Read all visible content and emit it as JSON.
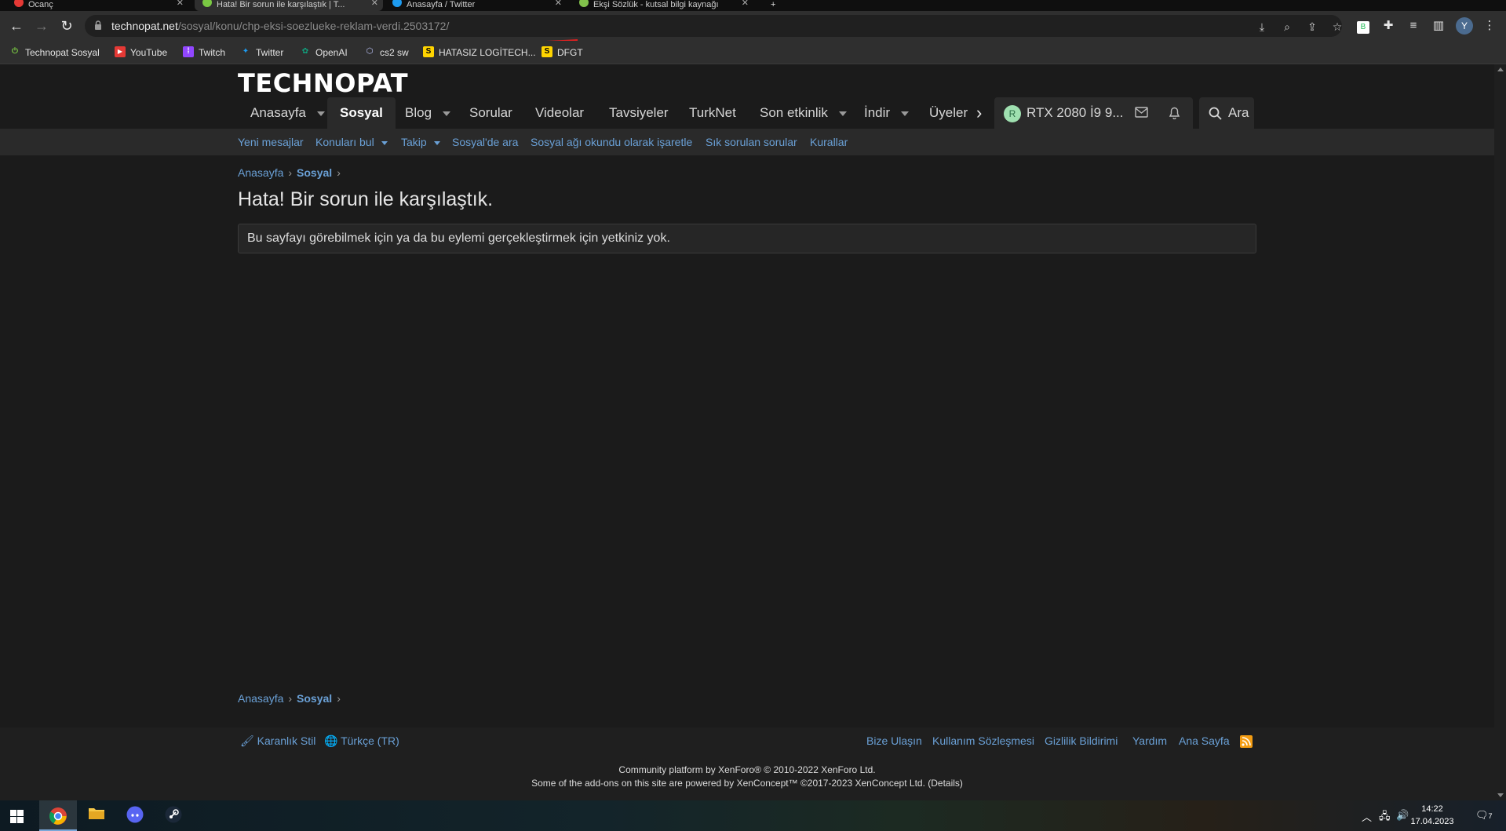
{
  "browser": {
    "tabs": [
      {
        "label": "Ocanç"
      },
      {
        "label": "Hata! Bir sorun ile karşılaştık | T..."
      },
      {
        "label": "Anasayfa / Twitter"
      },
      {
        "label": "Ekşi Sözlük - kutsal bilgi kaynağı"
      }
    ],
    "url_host": "technopat.net",
    "url_path": "/sosyal/konu/chp-eksi-soezlueke-reklam-verdi.2503172/",
    "profile_initial": "Y",
    "bookmarks": [
      {
        "label": "Technopat Sosyal",
        "icon": "power-icon"
      },
      {
        "label": "YouTube",
        "icon": "youtube-icon"
      },
      {
        "label": "Twitch",
        "icon": "twitch-icon"
      },
      {
        "label": "Twitter",
        "icon": "twitter-icon"
      },
      {
        "label": "OpenAI",
        "icon": "openai-icon"
      },
      {
        "label": "cs2 sw",
        "icon": "cs2-icon"
      },
      {
        "label": "HATASIZ LOGİTECH...",
        "icon": "s-icon"
      },
      {
        "label": "DFGT",
        "icon": "s-icon"
      }
    ]
  },
  "site": {
    "logo": "TECHNOPAT",
    "nav": [
      {
        "label": "Anasayfa"
      },
      {
        "label": "Sosyal"
      },
      {
        "label": "Blog"
      },
      {
        "label": "Sorular"
      },
      {
        "label": "Videolar"
      },
      {
        "label": "Tavsiyeler"
      },
      {
        "label": "TurkNet"
      },
      {
        "label": "Son etkinlik"
      },
      {
        "label": "İndir"
      },
      {
        "label": "Üyeler"
      }
    ],
    "user": {
      "initial": "R",
      "name": "RTX 2080 İ9 9..."
    },
    "search_label": "Ara",
    "subnav": [
      {
        "label": "Yeni mesajlar"
      },
      {
        "label": "Konuları bul"
      },
      {
        "label": "Takip"
      },
      {
        "label": "Sosyal'de ara"
      },
      {
        "label": "Sosyal ağı okundu olarak işaretle"
      },
      {
        "label": "Sık sorulan sorular"
      },
      {
        "label": "Kurallar"
      }
    ],
    "breadcrumb": {
      "home": "Anasayfa",
      "current": "Sosyal"
    },
    "error_title": "Hata! Bir sorun ile karşılaştık.",
    "error_message": "Bu sayfayı görebilmek için ya da bu eylemi gerçekleştirmek için yetkiniz yok.",
    "footer": {
      "style": "Karanlık Stil",
      "language": "Türkçe (TR)",
      "links": [
        {
          "label": "Bize Ulaşın"
        },
        {
          "label": "Kullanım Sözleşmesi"
        },
        {
          "label": "Gizlilik Bildirimi"
        },
        {
          "label": "Yardım"
        },
        {
          "label": "Ana Sayfa"
        }
      ],
      "copyright1": "Community platform by XenForo® © 2010-2022 XenForo Ltd.",
      "copyright2": "Some of the add-ons on this site are powered by XenConcept™ ©2017-2023 XenConcept Ltd. (Details)"
    }
  },
  "taskbar": {
    "time": "14:22",
    "date": "17.04.2023",
    "notification_count": "7"
  }
}
